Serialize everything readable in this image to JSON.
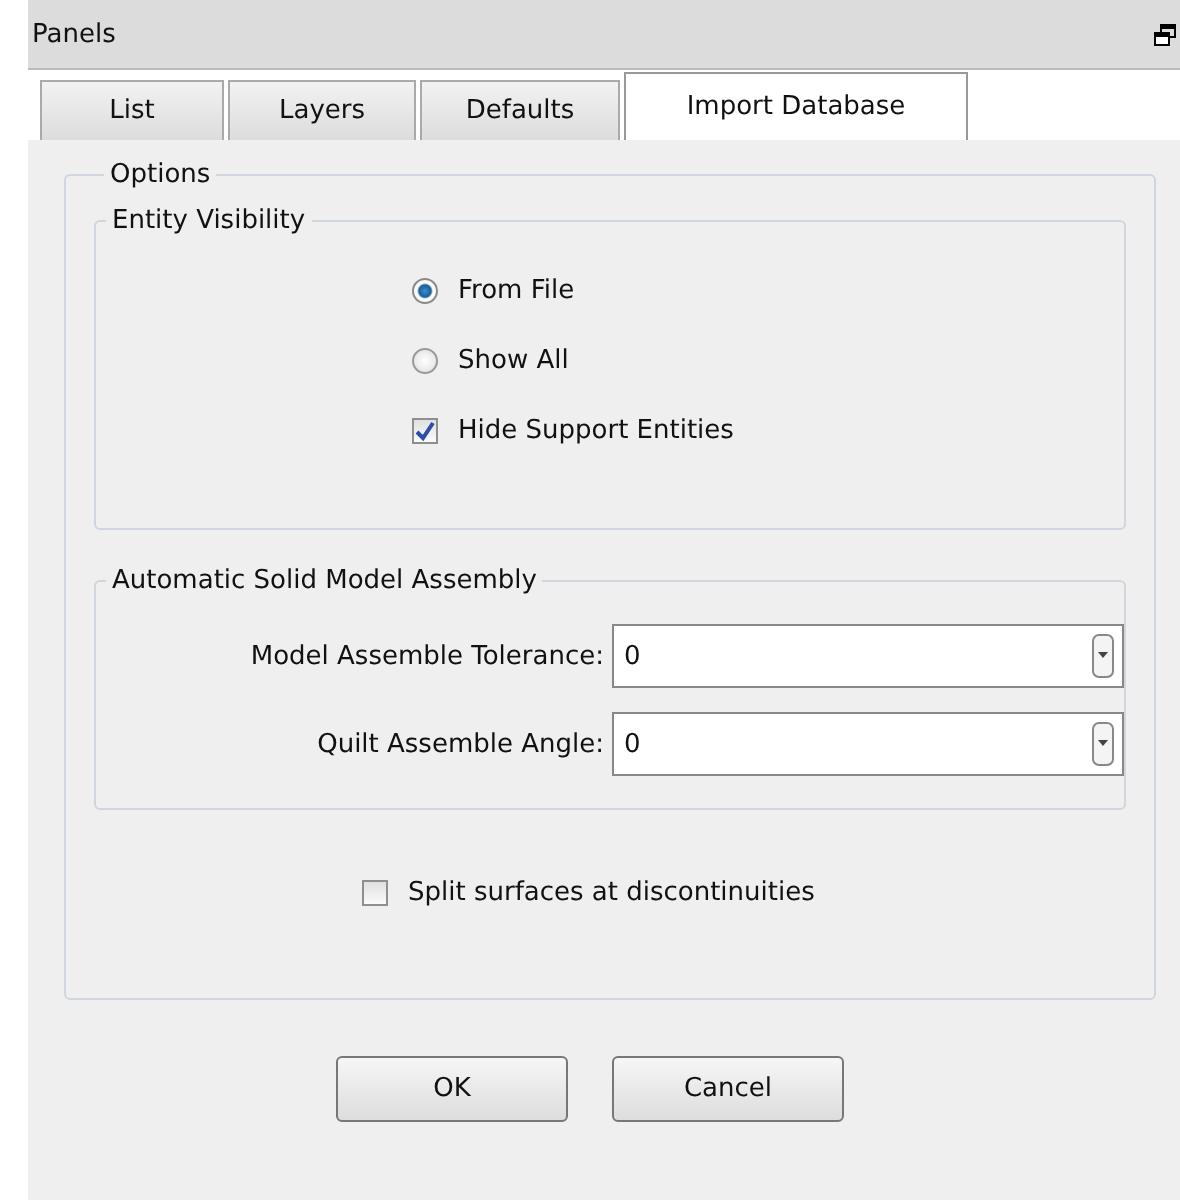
{
  "window": {
    "title": "Panels"
  },
  "tabs": [
    {
      "label": "List",
      "selected": false
    },
    {
      "label": "Layers",
      "selected": false
    },
    {
      "label": "Defaults",
      "selected": false
    },
    {
      "label": "Import Database",
      "selected": true
    }
  ],
  "options": {
    "title": "Options",
    "entity_visibility": {
      "title": "Entity Visibility",
      "items": [
        {
          "kind": "radio",
          "label": "From File",
          "selected": true
        },
        {
          "kind": "radio",
          "label": "Show All",
          "selected": false
        },
        {
          "kind": "checkbox",
          "label": "Hide Support Entities",
          "checked": true
        }
      ]
    },
    "assembly": {
      "title": "Automatic Solid Model Assembly",
      "fields": [
        {
          "label": "Model Assemble Tolerance:",
          "value": "0"
        },
        {
          "label": "Quilt Assemble Angle:",
          "value": "0"
        }
      ]
    },
    "split": {
      "label": "Split surfaces at discontinuities",
      "checked": false
    }
  },
  "buttons": [
    "OK",
    "Cancel"
  ]
}
